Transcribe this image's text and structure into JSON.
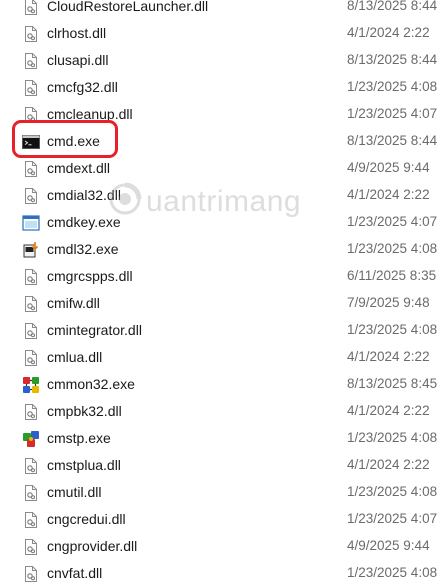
{
  "files": [
    {
      "name": "CloudRestoreLauncher.dll",
      "date": "8/13/2025 8:44",
      "icon": "dll-file-icon"
    },
    {
      "name": "clrhost.dll",
      "date": "4/1/2024 2:22",
      "icon": "dll-file-icon"
    },
    {
      "name": "clusapi.dll",
      "date": "8/13/2025 8:44",
      "icon": "dll-file-icon"
    },
    {
      "name": "cmcfg32.dll",
      "date": "1/23/2025 4:08",
      "icon": "dll-file-icon"
    },
    {
      "name": "cmcleanup.dll",
      "date": "1/23/2025 4:07",
      "icon": "dll-file-icon"
    },
    {
      "name": "cmd.exe",
      "date": "8/13/2025 8:44",
      "icon": "console-exe-icon"
    },
    {
      "name": "cmdext.dll",
      "date": "4/9/2025 9:44",
      "icon": "dll-file-icon"
    },
    {
      "name": "cmdial32.dll",
      "date": "4/1/2024 2:22",
      "icon": "dll-file-icon"
    },
    {
      "name": "cmdkey.exe",
      "date": "1/23/2025 4:07",
      "icon": "window-exe-icon"
    },
    {
      "name": "cmdl32.exe",
      "date": "1/23/2025 4:08",
      "icon": "download-exe-icon"
    },
    {
      "name": "cmgrcspps.dll",
      "date": "6/11/2025 8:35",
      "icon": "dll-file-icon"
    },
    {
      "name": "cmifw.dll",
      "date": "7/9/2025 9:48",
      "icon": "dll-file-icon"
    },
    {
      "name": "cmintegrator.dll",
      "date": "1/23/2025 4:08",
      "icon": "dll-file-icon"
    },
    {
      "name": "cmlua.dll",
      "date": "4/1/2024 2:22",
      "icon": "dll-file-icon"
    },
    {
      "name": "cmmon32.exe",
      "date": "8/13/2025 8:45",
      "icon": "connection-monitor-exe-icon"
    },
    {
      "name": "cmpbk32.dll",
      "date": "4/1/2024 2:22",
      "icon": "dll-file-icon"
    },
    {
      "name": "cmstp.exe",
      "date": "1/23/2025 4:08",
      "icon": "profile-installer-exe-icon"
    },
    {
      "name": "cmstplua.dll",
      "date": "4/1/2024 2:22",
      "icon": "dll-file-icon"
    },
    {
      "name": "cmutil.dll",
      "date": "1/23/2025 4:08",
      "icon": "dll-file-icon"
    },
    {
      "name": "cngcredui.dll",
      "date": "1/23/2025 4:07",
      "icon": "dll-file-icon"
    },
    {
      "name": "cngprovider.dll",
      "date": "4/9/2025 9:44",
      "icon": "dll-file-icon"
    },
    {
      "name": "cnvfat.dll",
      "date": "1/23/2025 4:08",
      "icon": "dll-file-icon"
    }
  ],
  "highlighted_file": "cmd.exe",
  "highlight_color": "#e8202a",
  "watermark": {
    "text": "uantrimang",
    "icon": "watermark-logo-icon"
  }
}
